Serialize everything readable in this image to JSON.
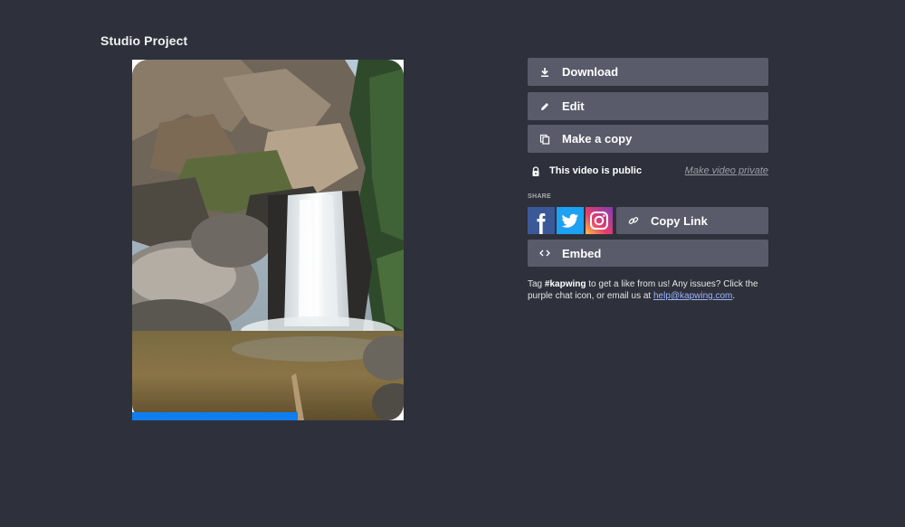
{
  "project": {
    "title": "Studio Project"
  },
  "video": {
    "progress": 0.61
  },
  "actions": {
    "download_label": "Download",
    "edit_label": "Edit",
    "copy_label": "Make a copy",
    "embed_label": "Embed"
  },
  "visibility": {
    "status_text": "This video is public",
    "toggle_label": "Make video private"
  },
  "share": {
    "heading": "SHARE",
    "copy_link_label": "Copy Link",
    "networks": [
      "facebook-icon",
      "twitter-icon",
      "instagram-icon"
    ]
  },
  "help": {
    "prefix": "Tag ",
    "hashtag": "#kapwing",
    "middle": " to get a like from us! Any issues? Click the purple chat icon, or email us at ",
    "email": "help@kapwing.com",
    "suffix": "."
  },
  "colors": {
    "background": "#2e313b",
    "button": "#595b6a",
    "progress": "#0f7ef0",
    "facebook": "#3b5998",
    "twitter": "#1da1f2",
    "link": "#9cb4ff"
  }
}
